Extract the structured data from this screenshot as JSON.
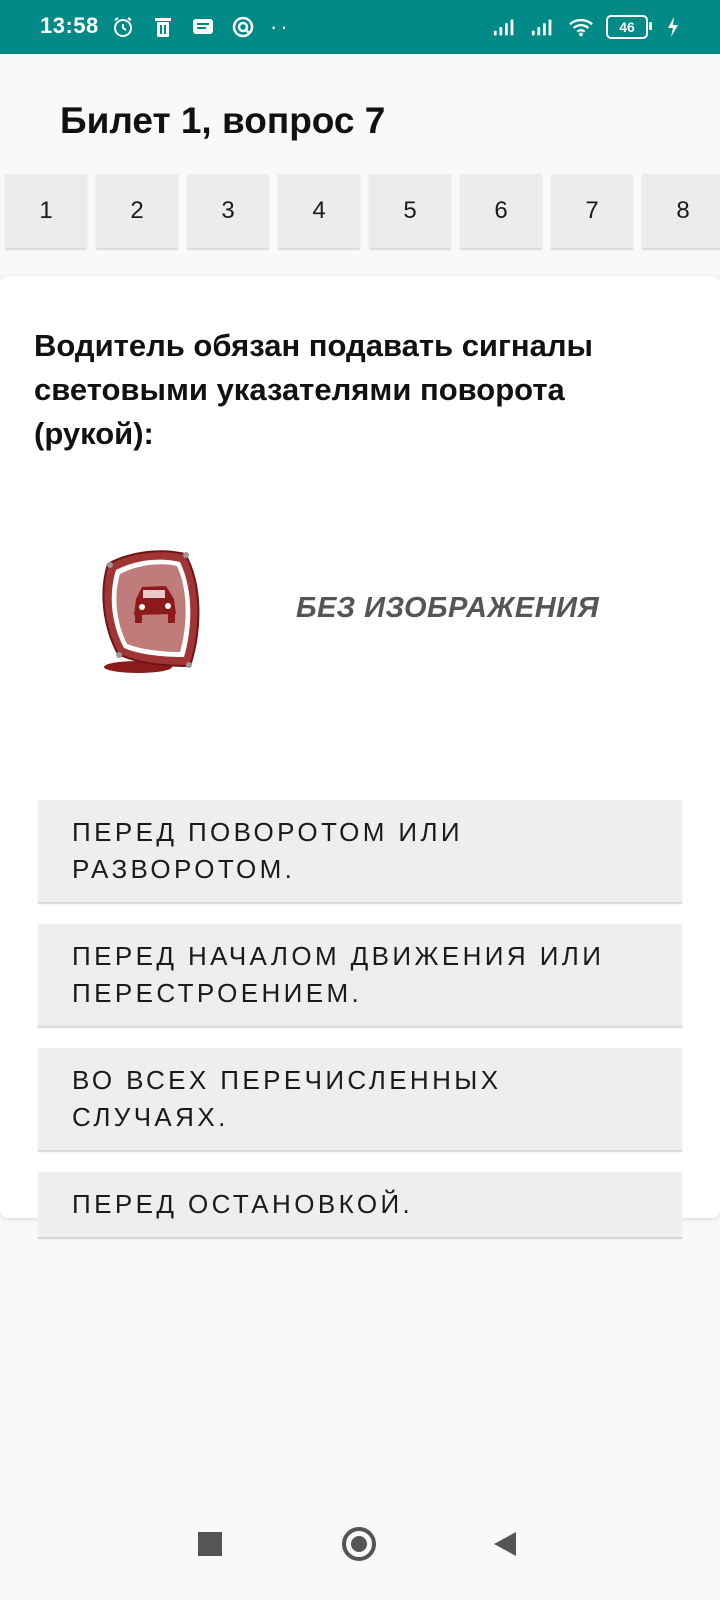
{
  "status_bar": {
    "time": "13:58",
    "battery": "46",
    "icons_left": [
      "alarm-icon",
      "trash-icon",
      "message-icon",
      "vpn-icon"
    ],
    "icons_right": [
      "signal-icon",
      "signal-icon",
      "wifi-icon",
      "battery-icon",
      "charging-icon"
    ],
    "more": "··"
  },
  "header": {
    "title": "Билет 1, вопрос 7"
  },
  "tabs": [
    "1",
    "2",
    "3",
    "4",
    "5",
    "6",
    "7",
    "8"
  ],
  "question": {
    "text": "Водитель обязан подавать сигналы световыми указателями поворота (рукой):",
    "image_placeholder": "БЕЗ ИЗОБРАЖЕНИЯ"
  },
  "answers": [
    "ПЕРЕД ПОВОРОТОМ ИЛИ РАЗВОРОТОМ.",
    "ПЕРЕД НАЧАЛОМ ДВИЖЕНИЯ ИЛИ ПЕРЕСТРОЕНИЕМ.",
    "ВО ВСЕХ ПЕРЕЧИСЛЕННЫХ СЛУЧАЯХ.",
    "ПЕРЕД ОСТАНОВКОЙ."
  ],
  "colors": {
    "status_bar": "#008a87",
    "logo": "#8b1a1a"
  }
}
